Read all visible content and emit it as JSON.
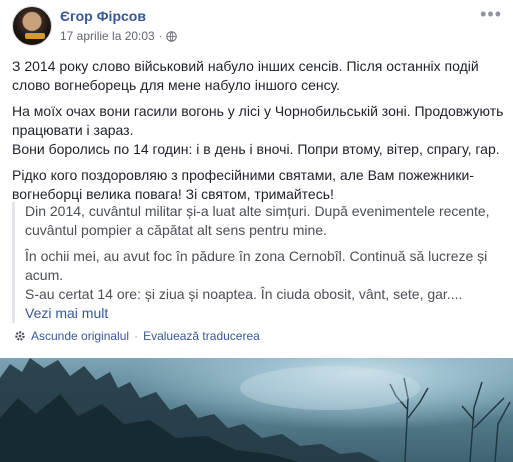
{
  "post": {
    "author": "Єгор Фірсов",
    "timestamp": "17 aprilie la 20:03",
    "separator": "·",
    "privacy_icon": "globe-icon",
    "more_icon": "•••"
  },
  "original_text": {
    "p1": "З 2014 року слово військовий набуло інших сенсів. Після останніх подій слово вогнеборець для мене набуло іншого сенсу.",
    "p2a": "На моїх очах вони гасили вогонь у лісі у Чорнобильській зоні. Продовжують працювати і зараз.",
    "p2b": "Вони боролись по 14 годин: і в день і вночі. Попри втому, вітер, спрагу, гар.",
    "p3": "Рідко кого поздоровляю з професійними святами, але Вам пожежники-вогнеборці велика повага! Зі святом, тримайтесь!"
  },
  "translation": {
    "p1": "Din 2014, cuvântul militar și-a luat alte simțuri. După evenimentele recente, cuvântul pompier a căpătat alt sens pentru mine.",
    "p2a": "În ochii mei, au avut foc în pădure în zona Cernobîl. Continuă să lucreze și acum.",
    "p2b": "S-au certat 14 ore: și ziua și noaptea. În ciuda obosit, vânt, sete, gar....",
    "see_more": "Vezi mai mult"
  },
  "translation_footer": {
    "settings_icon": "gear-icon",
    "hide_original": "Ascunde originalul",
    "separator": "·",
    "rate_translation": "Evaluează traducerea"
  },
  "colors": {
    "link": "#365899",
    "text": "#1d2129",
    "meta": "#616770"
  }
}
